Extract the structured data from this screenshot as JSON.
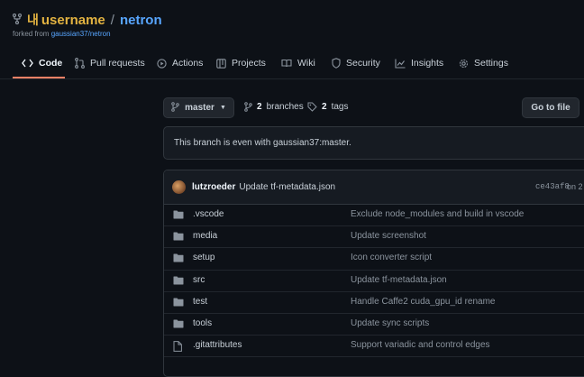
{
  "repo": {
    "owner_badge": "내",
    "owner": "username",
    "separator": "/",
    "name": "netron",
    "forked_prefix": "forked from",
    "forked_source": "gaussian37/netron"
  },
  "tabs": [
    {
      "label": "Code",
      "icon": "code-icon",
      "active": true
    },
    {
      "label": "Pull requests",
      "icon": "pull-request-icon"
    },
    {
      "label": "Actions",
      "icon": "play-icon"
    },
    {
      "label": "Projects",
      "icon": "table-icon"
    },
    {
      "label": "Wiki",
      "icon": "book-icon"
    },
    {
      "label": "Security",
      "icon": "shield-icon"
    },
    {
      "label": "Insights",
      "icon": "graph-icon"
    },
    {
      "label": "Settings",
      "icon": "gear-icon"
    }
  ],
  "toolbar": {
    "branch": "master",
    "branches_count": "2",
    "branches_label": "branches",
    "tags_count": "2",
    "tags_label": "tags",
    "go_to_file": "Go to file"
  },
  "notice": "This branch is even with gaussian37:master.",
  "commit": {
    "author": "lutzroeder",
    "message": "Update tf-metadata.json",
    "sha": "ce43af8",
    "date": "on 2"
  },
  "files": [
    {
      "name": ".vscode",
      "type": "folder",
      "message": "Exclude node_modules and build in vscode"
    },
    {
      "name": "media",
      "type": "folder",
      "message": "Update screenshot"
    },
    {
      "name": "setup",
      "type": "folder",
      "message": "Icon converter script"
    },
    {
      "name": "src",
      "type": "folder",
      "message": "Update tf-metadata.json"
    },
    {
      "name": "test",
      "type": "folder",
      "message": "Handle Caffe2 cuda_gpu_id rename"
    },
    {
      "name": "tools",
      "type": "folder",
      "message": "Update sync scripts"
    },
    {
      "name": ".gitattributes",
      "type": "file",
      "message": "Support variadic and control edges"
    }
  ],
  "colors": {
    "background": "#0d1117",
    "link": "#58a6ff",
    "owner": "#e3b341",
    "active_tab_underline": "#f78166",
    "folder": "#8b949e"
  }
}
